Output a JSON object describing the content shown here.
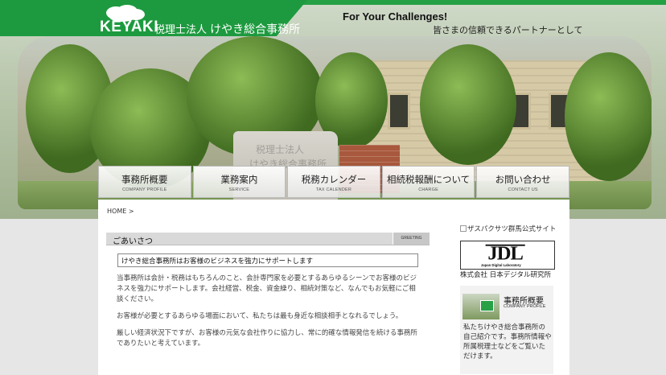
{
  "header": {
    "logo_text": "KEYAKI",
    "firm_prefix": "税理士法人",
    "firm_name": "けやき総合事務所",
    "tagline": "For Your Challenges!",
    "tagline_jp": "皆さまの信頼できるパートナーとして",
    "stone_line1": "税理士法人",
    "stone_line2": "けやき総合事務所"
  },
  "nav": [
    {
      "label": "事務所概要",
      "sub": "COMPANY PROFILE"
    },
    {
      "label": "業務案内",
      "sub": "SERVICE"
    },
    {
      "label": "税務カレンダー",
      "sub": "TAX CALENDER"
    },
    {
      "label": "相続税報酬について",
      "sub": "CHARGE"
    },
    {
      "label": "お問い合わせ",
      "sub": "CONTACT US"
    }
  ],
  "breadcrumb": "HOME >",
  "greeting": {
    "heading": "ごあいさつ",
    "heading_en": "GREETING",
    "lead": "けやき総合事務所はお客様のビジネスを強力にサポートします",
    "paragraphs": [
      "当事務所は会計・税務はもちろんのこと、会計専門家を必要とするあらゆるシーンでお客様のビジネスを強力にサポートします。会社経営、税金、資金繰り、相続対策など、なんでもお気軽にご相談ください。",
      "お客様が必要とするあらゆる場面において、私たちは最も身近な相談相手となれるでしょう。",
      "厳しい経済状況下ですが、お客様の元気な会社作りに協力し、常に的確な情報発信を続ける事務所でありたいと考えています。"
    ]
  },
  "sidebar": {
    "link_alt": "ザスパクサツ群馬公式サイト",
    "jdl_caption": "株式会社 日本デジタル研究所",
    "jdl_logo_sub": "Japan Digital Laboratory",
    "card_title": "事務所概要",
    "card_sub": "COMPANY PROFILE",
    "card_desc": "私たちけやき総合事務所の自己紹介です。事務所情報や所属税理士などをご覧いただけます。"
  },
  "colors": {
    "brand_green": "#1d9a3f",
    "background": "#e6e6e6"
  }
}
